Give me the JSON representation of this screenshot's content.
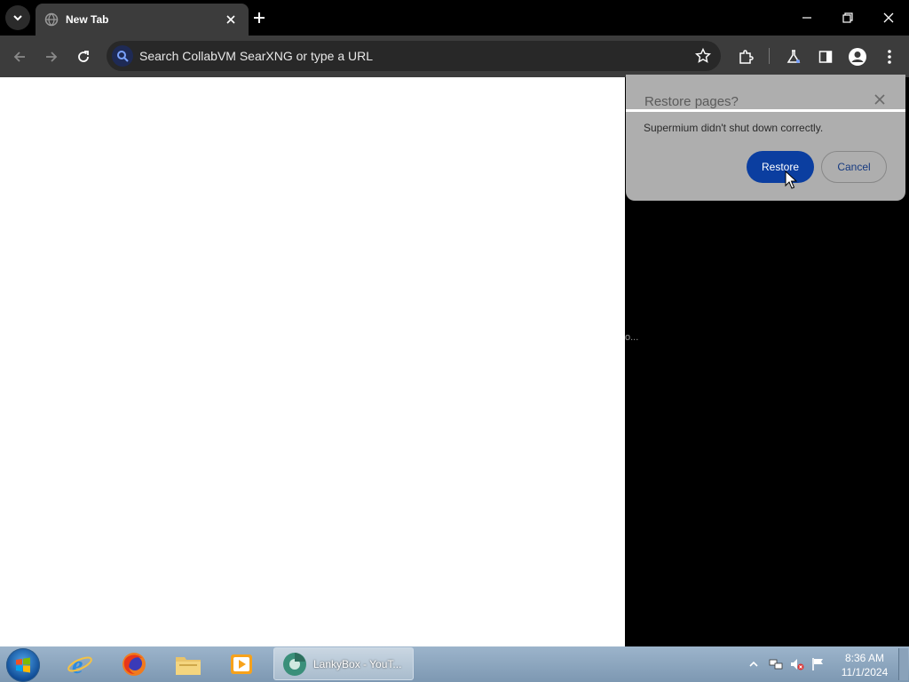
{
  "browser": {
    "tab": {
      "title": "New Tab"
    },
    "omnibox": {
      "text": "Search CollabVM SearXNG or type a URL"
    }
  },
  "dialog": {
    "title": "Restore pages?",
    "message": "Supermium didn't shut down correctly.",
    "restore_label": "Restore",
    "cancel_label": "Cancel"
  },
  "content": {
    "stray_text": "o..."
  },
  "taskbar": {
    "task_label": "LankyBox - YouT...",
    "clock": {
      "time": "8:36 AM",
      "date": "11/1/2024"
    }
  },
  "colors": {
    "tab_bg": "#3c3c3c",
    "restore_button": "#0b3ea0",
    "dialog_bg": "#aeaeae"
  },
  "icons": [
    "chevron-down-icon",
    "globe-icon",
    "close-icon",
    "plus-icon",
    "minimize-icon",
    "restore-window-icon",
    "back-icon",
    "forward-icon",
    "reload-icon",
    "search-icon",
    "star-icon",
    "extensions-icon",
    "labs-icon",
    "side-panel-icon",
    "profile-icon",
    "kebab-menu-icon",
    "windows-logo-icon",
    "ie-icon",
    "firefox-icon",
    "folder-icon",
    "media-player-icon",
    "flag-icon"
  ]
}
